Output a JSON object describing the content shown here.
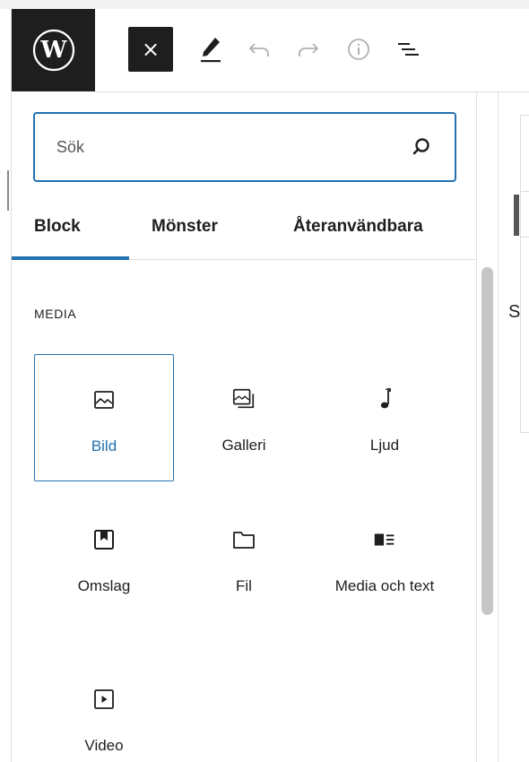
{
  "toolbar": {
    "logo": "wordpress-logo",
    "close_label": "×",
    "icons": [
      "pencil-icon",
      "undo-icon",
      "redo-icon",
      "info-icon",
      "list-view-icon"
    ]
  },
  "inserter": {
    "search": {
      "placeholder": "Sök",
      "value": ""
    },
    "tabs": [
      {
        "label": "Block",
        "active": true
      },
      {
        "label": "Mönster",
        "active": false
      },
      {
        "label": "Återanvändbara",
        "active": false
      }
    ],
    "section_title": "MEDIA",
    "blocks": [
      {
        "label": "Bild",
        "icon": "image-icon",
        "selected": true
      },
      {
        "label": "Galleri",
        "icon": "gallery-icon",
        "selected": false
      },
      {
        "label": "Ljud",
        "icon": "audio-icon",
        "selected": false
      },
      {
        "label": "Omslag",
        "icon": "cover-icon",
        "selected": false
      },
      {
        "label": "Fil",
        "icon": "file-icon",
        "selected": false
      },
      {
        "label": "Media och text",
        "icon": "media-text-icon",
        "selected": false
      },
      {
        "label": "Video",
        "icon": "video-icon",
        "selected": false
      }
    ]
  },
  "right_panel": {
    "partial_text": "S"
  },
  "colors": {
    "accent": "#2271b1",
    "dark": "#1e1e1e",
    "border": "#e0e0e0"
  }
}
